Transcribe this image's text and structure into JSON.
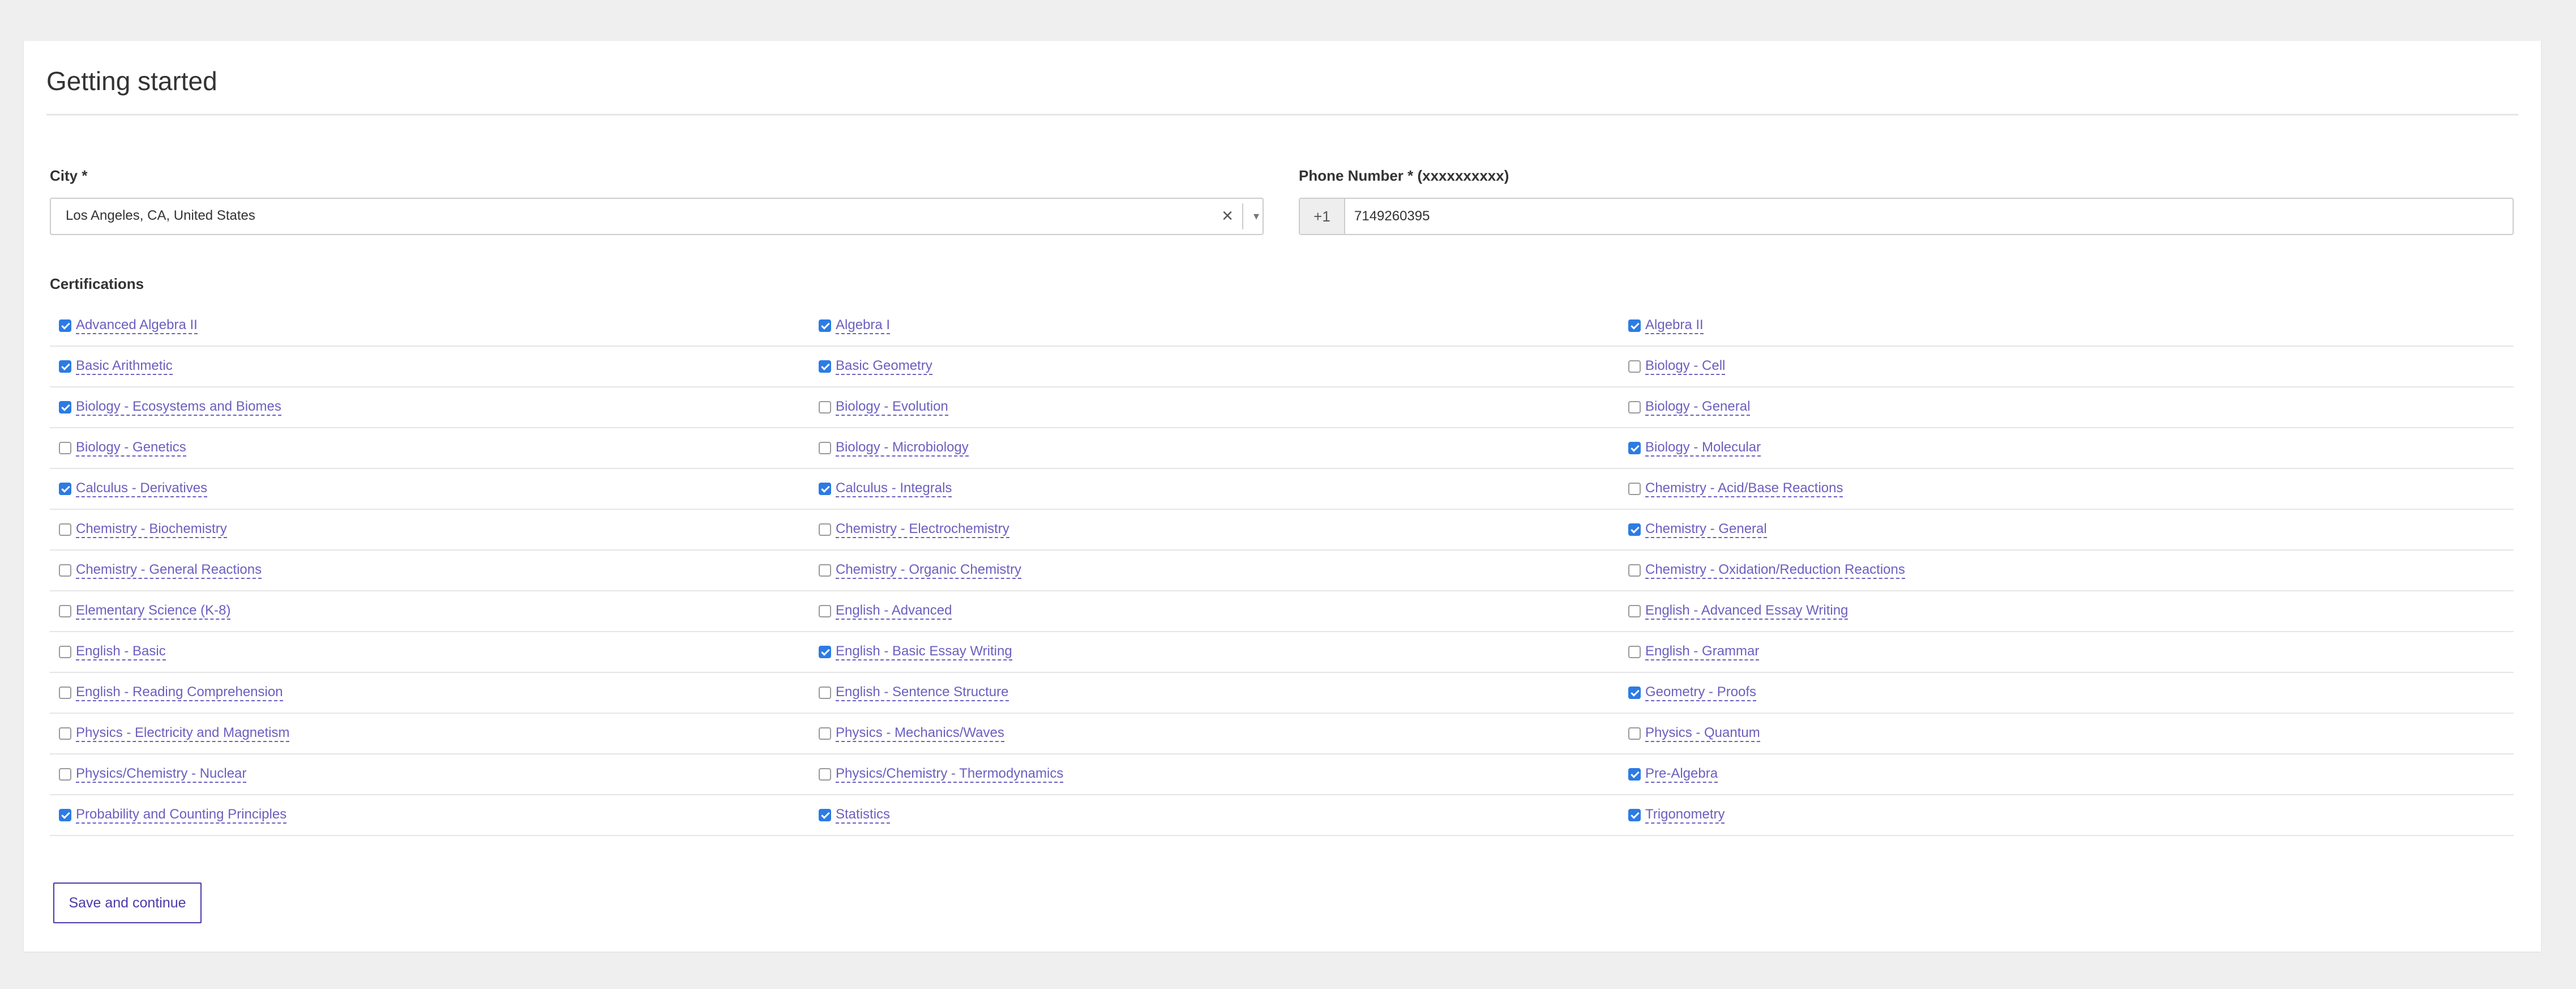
{
  "page": {
    "title": "Getting started"
  },
  "city": {
    "label": "City *",
    "value": "Los Angeles, CA, United States",
    "clear_glyph": "×",
    "open_glyph": "▾"
  },
  "phone": {
    "label": "Phone Number * (xxxxxxxxxx)",
    "prefix": "+1",
    "value": "7149260395"
  },
  "certifications": {
    "label": "Certifications",
    "items": [
      {
        "label": "Advanced Algebra II",
        "checked": true
      },
      {
        "label": "Algebra I",
        "checked": true
      },
      {
        "label": "Algebra II",
        "checked": true
      },
      {
        "label": "Basic Arithmetic",
        "checked": true
      },
      {
        "label": "Basic Geometry",
        "checked": true
      },
      {
        "label": "Biology - Cell",
        "checked": false
      },
      {
        "label": "Biology - Ecosystems and Biomes",
        "checked": true
      },
      {
        "label": "Biology - Evolution",
        "checked": false
      },
      {
        "label": "Biology - General",
        "checked": false
      },
      {
        "label": "Biology - Genetics",
        "checked": false
      },
      {
        "label": "Biology - Microbiology",
        "checked": false
      },
      {
        "label": "Biology - Molecular",
        "checked": true
      },
      {
        "label": "Calculus - Derivatives",
        "checked": true
      },
      {
        "label": "Calculus - Integrals",
        "checked": true
      },
      {
        "label": "Chemistry - Acid/Base Reactions",
        "checked": false
      },
      {
        "label": "Chemistry - Biochemistry",
        "checked": false
      },
      {
        "label": "Chemistry - Electrochemistry",
        "checked": false
      },
      {
        "label": "Chemistry - General",
        "checked": true
      },
      {
        "label": "Chemistry - General Reactions",
        "checked": false
      },
      {
        "label": "Chemistry - Organic Chemistry",
        "checked": false
      },
      {
        "label": "Chemistry - Oxidation/Reduction Reactions",
        "checked": false
      },
      {
        "label": "Elementary Science (K-8)",
        "checked": false
      },
      {
        "label": "English - Advanced",
        "checked": false
      },
      {
        "label": "English - Advanced Essay Writing",
        "checked": false
      },
      {
        "label": "English - Basic",
        "checked": false
      },
      {
        "label": "English - Basic Essay Writing",
        "checked": true
      },
      {
        "label": "English - Grammar",
        "checked": false
      },
      {
        "label": "English - Reading Comprehension",
        "checked": false
      },
      {
        "label": "English - Sentence Structure",
        "checked": false
      },
      {
        "label": "Geometry - Proofs",
        "checked": true
      },
      {
        "label": "Physics - Electricity and Magnetism",
        "checked": false
      },
      {
        "label": "Physics - Mechanics/Waves",
        "checked": false
      },
      {
        "label": "Physics - Quantum",
        "checked": false
      },
      {
        "label": "Physics/Chemistry - Nuclear",
        "checked": false
      },
      {
        "label": "Physics/Chemistry - Thermodynamics",
        "checked": false
      },
      {
        "label": "Pre-Algebra",
        "checked": true
      },
      {
        "label": "Probability and Counting Principles",
        "checked": true
      },
      {
        "label": "Statistics",
        "checked": true
      },
      {
        "label": "Trigonometry",
        "checked": true
      }
    ]
  },
  "actions": {
    "save_label": "Save and continue"
  },
  "colors": {
    "page_bg": "#efefef",
    "card_bg": "#ffffff",
    "checkbox_checked": "#2c7be5",
    "link": "#6b5fbf",
    "button_accent": "#4b3aa8"
  }
}
